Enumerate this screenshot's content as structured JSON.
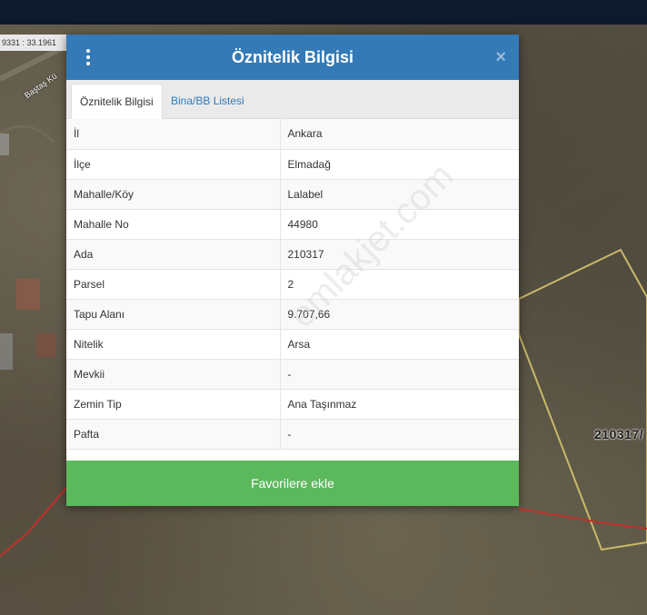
{
  "map": {
    "coordinate_text": "9331 : 33.1961",
    "road_label": "Baştaş Kü",
    "parcel_label": "210317/"
  },
  "dialog": {
    "title": "Öznitelik Bilgisi",
    "close_symbol": "×",
    "tabs": [
      {
        "label": "Öznitelik Bilgisi",
        "active": true
      },
      {
        "label": "Bina/BB Listesi",
        "active": false
      }
    ],
    "rows": [
      {
        "key": "İl",
        "value": "Ankara"
      },
      {
        "key": "İlçe",
        "value": "Elmadağ"
      },
      {
        "key": "Mahalle/Köy",
        "value": "Lalabel"
      },
      {
        "key": "Mahalle No",
        "value": "44980"
      },
      {
        "key": "Ada",
        "value": "210317"
      },
      {
        "key": "Parsel",
        "value": "2"
      },
      {
        "key": "Tapu Alanı",
        "value": "9.707,66"
      },
      {
        "key": "Nitelik",
        "value": "Arsa"
      },
      {
        "key": "Mevkii",
        "value": "-"
      },
      {
        "key": "Zemin Tip",
        "value": "Ana Taşınmaz"
      },
      {
        "key": "Pafta",
        "value": "-"
      }
    ],
    "favorite_button": "Favorilere ekle"
  },
  "watermark": "emlakjet.com",
  "colors": {
    "header": "#337ab7",
    "favorite": "#5cb85c",
    "parcel_outline": "#c9b96a",
    "boundary_line": "#c0302a"
  }
}
